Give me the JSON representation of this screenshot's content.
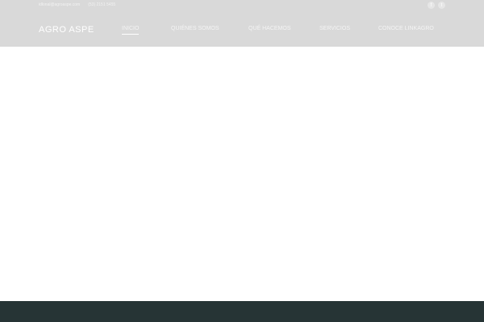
{
  "topbar": {
    "email": "idlonal@agroaspe.com",
    "phone": "(53) 2151 5455"
  },
  "logo": "AGRO ASPE",
  "nav": [
    "INICIO",
    "QUIÉNES SOMOS",
    "QUÉ HACEMOS",
    "SERVICIOS",
    "CONOCE LINKAGRO"
  ],
  "social": {
    "facebook": "f",
    "twitter": "t"
  }
}
